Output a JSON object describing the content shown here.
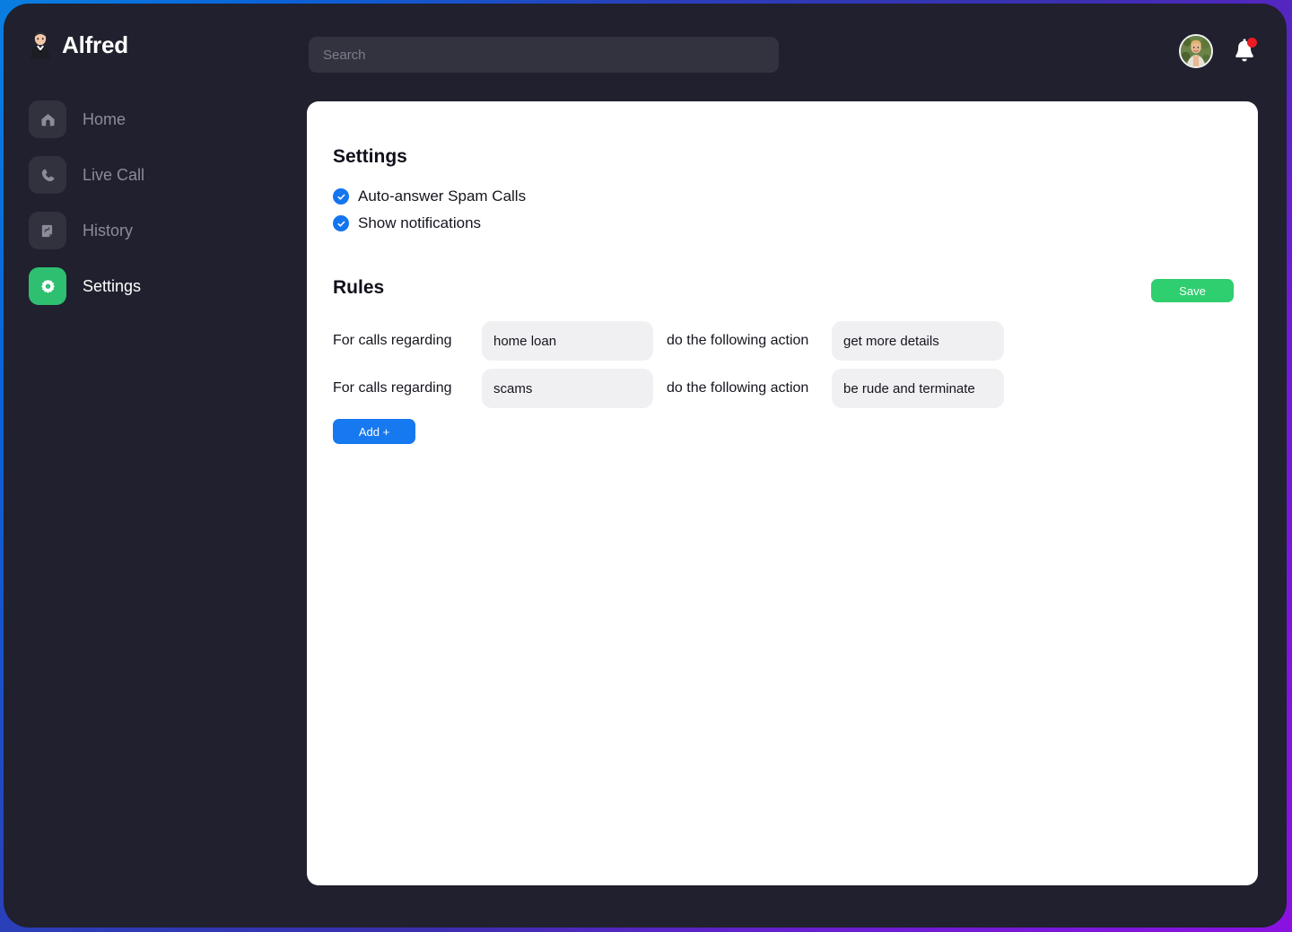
{
  "app": {
    "brand_name": "Alfred",
    "brand_logo_icon": "butler-emoji"
  },
  "topbar": {
    "search_placeholder": "Search",
    "search_value": "",
    "avatar_icon": "user-avatar-photo",
    "bell_icon": "notification-bell-icon",
    "has_unread": true
  },
  "sidebar": {
    "items": [
      {
        "label": "Home",
        "icon": "home-icon",
        "active": false
      },
      {
        "label": "Live Call",
        "icon": "phone-icon",
        "active": false
      },
      {
        "label": "History",
        "icon": "document-icon",
        "active": false
      },
      {
        "label": "Settings",
        "icon": "gear-icon",
        "active": true
      }
    ]
  },
  "main": {
    "settings": {
      "title": "Settings",
      "checkboxes": [
        {
          "label": "Auto-answer Spam Calls",
          "checked": true
        },
        {
          "label": "Show notifications",
          "checked": true
        }
      ]
    },
    "rules": {
      "title": "Rules",
      "save_label": "Save",
      "add_label": "Add +",
      "lead_text": "For calls regarding",
      "mid_text": "do the following action",
      "rows": [
        {
          "topic": "home loan",
          "action": "get more details"
        },
        {
          "topic": "scams",
          "action": "be rude and terminate"
        }
      ]
    }
  },
  "colors": {
    "window_bg": "#20202e",
    "card_bg": "#ffffff",
    "accent_green": "#2fce6e",
    "accent_blue": "#1779ef",
    "check_blue": "#1375ef",
    "nav_active_green": "#2fbf71",
    "badge_red": "#ec1c24"
  }
}
